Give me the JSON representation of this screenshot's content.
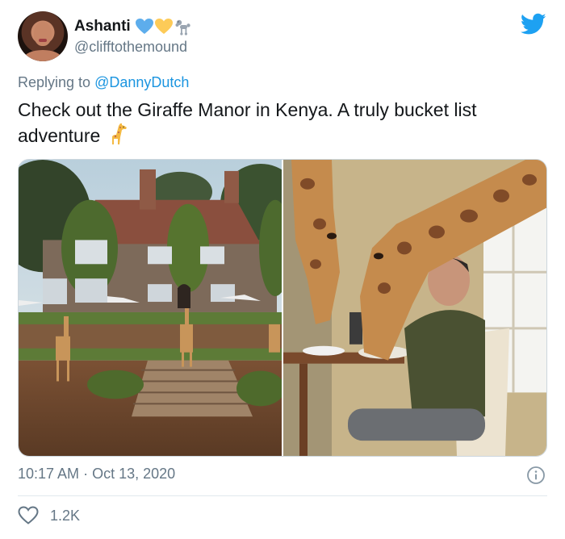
{
  "author": {
    "display_name": "Ashanti",
    "handle": "@clifftothemound",
    "name_emojis": [
      "blue-heart-icon",
      "yellow-heart-icon",
      "poodle-icon"
    ]
  },
  "reply": {
    "prefix": "Replying to ",
    "mention": "@DannyDutch"
  },
  "tweet": {
    "text": "Check out the Giraffe Manor in Kenya. A truly bucket list adventure",
    "emoji": "giraffe-icon"
  },
  "media": {
    "photos": [
      {
        "subject": "giraffe-manor-exterior-photo"
      },
      {
        "subject": "giraffes-breakfast-photo"
      }
    ]
  },
  "meta": {
    "time": "10:17 AM",
    "separator": " · ",
    "date": "Oct 13, 2020"
  },
  "engagement": {
    "likes": "1.2K"
  },
  "colors": {
    "twitter_blue": "#1da1f2",
    "link_blue": "#1b95e0",
    "secondary_text": "#657786",
    "primary_text": "#14171a"
  }
}
